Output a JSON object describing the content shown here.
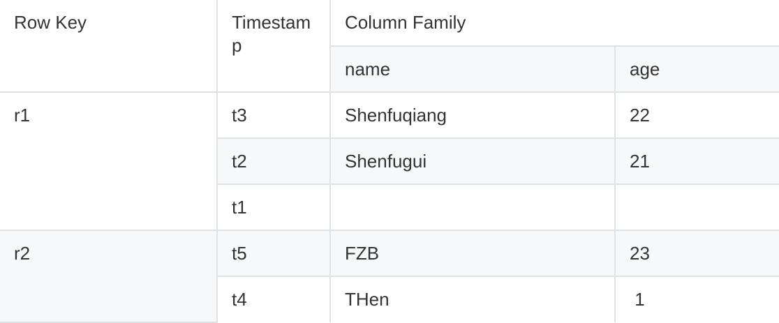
{
  "table": {
    "headers": {
      "row_key": "Row Key",
      "timestamp": "Timestamp",
      "column_family": "Column Family",
      "name": "name",
      "age": "age"
    },
    "groups": [
      {
        "row_key": "r1",
        "rows": [
          {
            "timestamp": "t3",
            "name": "Shenfuqiang",
            "age": "22"
          },
          {
            "timestamp": "t2",
            "name": "Shenfugui",
            "age": "21"
          },
          {
            "timestamp": "t1",
            "name": "",
            "age": ""
          }
        ]
      },
      {
        "row_key": "r2",
        "rows": [
          {
            "timestamp": "t5",
            "name": "FZB",
            "age": "23"
          },
          {
            "timestamp": "t4",
            "name": "THen",
            "age": " 1"
          }
        ]
      }
    ]
  }
}
